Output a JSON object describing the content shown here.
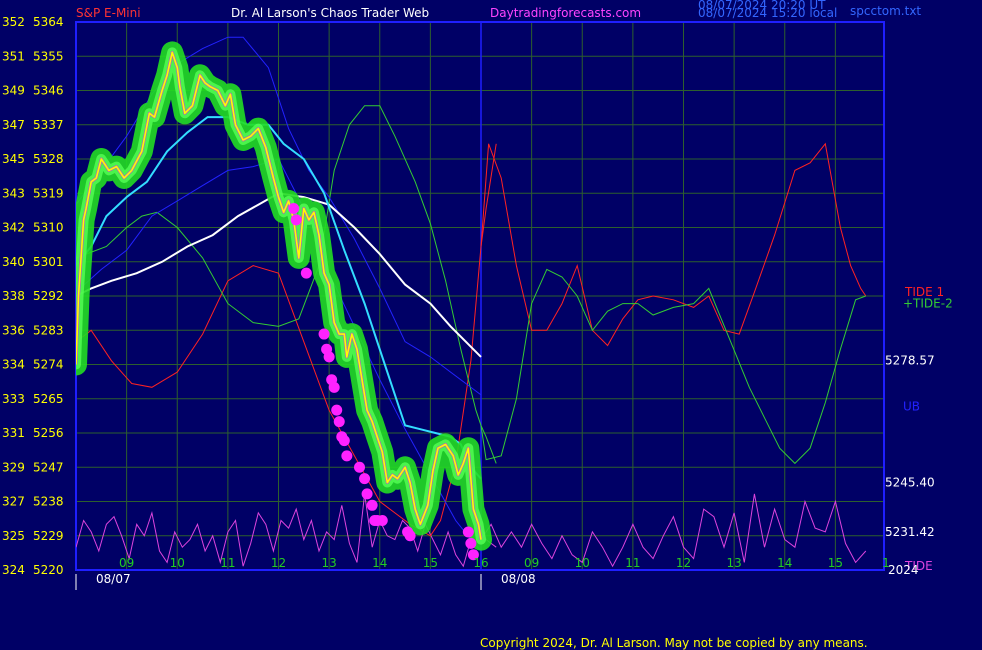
{
  "header": {
    "instrument": "S&P E-Mini",
    "title": "Dr. Al Larson's Chaos Trader Web",
    "site": "Daytradingforecasts.com",
    "stamp_ut": "08/07/2024 20:20 UT",
    "stamp_local": "08/07/2024 15:20 local",
    "file": "spcctom.txt"
  },
  "footer": {
    "copyright": "Copyright 2024, Dr. Al Larson. May not be copied by any means."
  },
  "colors": {
    "background": "#000066",
    "grid": "#2d5f2d",
    "axis": "#1f1fff",
    "title_red": "#ff3333",
    "title_white": "#ffffff",
    "site_magenta": "#ff44ff",
    "stamp_blue": "#3366ff",
    "price": "#ffff00",
    "price_glow": "#22dd22",
    "white_ma": "#ffffff",
    "cyan_ma": "#33ddff",
    "blue_band": "#2222ff",
    "tide1": "#ff2222",
    "tide2": "#33cc33",
    "tide": "#dd44dd"
  },
  "chart_data": {
    "type": "line",
    "x_domain": [
      8.0,
      16.3
    ],
    "forecast_split": 16.0,
    "y_left_pairs": [
      [
        "352",
        "5364"
      ],
      [
        "351",
        "5355"
      ],
      [
        "349",
        "5346"
      ],
      [
        "347",
        "5337"
      ],
      [
        "345",
        "5328"
      ],
      [
        "343",
        "5319"
      ],
      [
        "342",
        "5310"
      ],
      [
        "340",
        "5301"
      ],
      [
        "338",
        "5292"
      ],
      [
        "336",
        "5283"
      ],
      [
        "334",
        "5274"
      ],
      [
        "333",
        "5265"
      ],
      [
        "331",
        "5256"
      ],
      [
        "329",
        "5247"
      ],
      [
        "327",
        "5238"
      ],
      [
        "325",
        "5229"
      ],
      [
        "324",
        "5220"
      ]
    ],
    "ylim": [
      5220,
      5364
    ],
    "x_ticks_day1": [
      "09",
      "10",
      "11",
      "12",
      "13",
      "14",
      "15",
      "16"
    ],
    "x_ticks_day2": [
      "09",
      "10",
      "11",
      "12",
      "13",
      "14",
      "15",
      "1"
    ],
    "date_labels": [
      "08/07",
      "08/08"
    ],
    "right_labels": [
      {
        "text": "5278.57",
        "price": 5275
      },
      {
        "text": "5245.40",
        "price": 5243
      },
      {
        "text": "5231.42",
        "price": 5230
      }
    ],
    "right_series_labels": [
      {
        "text": "TIDE 1",
        "color": "#ff2222",
        "price": 5293
      },
      {
        "text": "+TIDE-2",
        "color": "#33cc33",
        "price": 5290
      },
      {
        "text": "UB",
        "color": "#2222ff",
        "price": 5263
      },
      {
        "text": "TIDE",
        "color": "#dd44dd",
        "price": 5221
      },
      {
        "text": "2024",
        "color": "#ffffff",
        "price": 5220
      }
    ],
    "series": [
      {
        "key": "price",
        "color": "#ffff00",
        "x": [
          8.0,
          8.05,
          8.15,
          8.2,
          8.3,
          8.4,
          8.5,
          8.65,
          8.8,
          8.95,
          9.1,
          9.3,
          9.45,
          9.55,
          9.7,
          9.8,
          9.9,
          10.0,
          10.05,
          10.15,
          10.3,
          10.45,
          10.55,
          10.65,
          10.8,
          10.95,
          11.05,
          11.15,
          11.3,
          11.45,
          11.6,
          11.75,
          11.9,
          12.0,
          12.1,
          12.2,
          12.3,
          12.4,
          12.5,
          12.6,
          12.7,
          12.8,
          12.9,
          13.0,
          13.1,
          13.2,
          13.3,
          13.35,
          13.45,
          13.55,
          13.65,
          13.75,
          13.85,
          13.95,
          14.05,
          14.15,
          14.25,
          14.35,
          14.5,
          14.6,
          14.7,
          14.8,
          14.95,
          15.05,
          15.15,
          15.3,
          15.45,
          15.55,
          15.65,
          15.75,
          15.85,
          15.95,
          16.0
        ],
        "y": [
          5274,
          5292,
          5312,
          5315,
          5322,
          5323,
          5328,
          5325,
          5326,
          5323,
          5325,
          5330,
          5340,
          5339,
          5346,
          5350,
          5356,
          5352,
          5347,
          5340,
          5342,
          5350,
          5348,
          5347,
          5346,
          5342,
          5345,
          5337,
          5333,
          5334,
          5336,
          5331,
          5323,
          5318,
          5314,
          5317,
          5312,
          5302,
          5315,
          5312,
          5314,
          5308,
          5298,
          5295,
          5285,
          5282,
          5282,
          5276,
          5282,
          5278,
          5270,
          5262,
          5259,
          5255,
          5251,
          5243,
          5245,
          5244,
          5247,
          5243,
          5236,
          5232,
          5237,
          5246,
          5252,
          5253,
          5250,
          5245,
          5248,
          5252,
          5236,
          5232,
          5228
        ]
      },
      {
        "key": "white",
        "color": "#ffffff",
        "x": [
          8.0,
          8.3,
          8.7,
          9.2,
          9.7,
          10.2,
          10.7,
          11.2,
          11.6,
          12.0,
          12.5,
          13.0,
          13.5,
          14.0,
          14.5,
          15.0,
          15.4,
          15.7,
          16.0
        ],
        "y": [
          5292,
          5294,
          5296,
          5298,
          5301,
          5305,
          5308,
          5313,
          5316,
          5319,
          5318,
          5316,
          5310,
          5303,
          5295,
          5290,
          5284,
          5280,
          5276
        ]
      },
      {
        "key": "cyan",
        "color": "#33ddff",
        "x": [
          8.0,
          8.3,
          8.6,
          9.0,
          9.4,
          9.8,
          10.2,
          10.6,
          11.0,
          11.4,
          11.8,
          12.1,
          12.5,
          12.9,
          13.3,
          13.7,
          14.1,
          14.5,
          14.8,
          15.1,
          15.4,
          15.6,
          15.8,
          16.0
        ],
        "y": [
          5300,
          5305,
          5313,
          5318,
          5322,
          5330,
          5335,
          5339,
          5339,
          5337,
          5337,
          5332,
          5328,
          5319,
          5304,
          5290,
          5274,
          5258,
          5257,
          5256,
          5255,
          5253,
          5247,
          5244
        ]
      },
      {
        "key": "blue_upper",
        "color": "#2222ff",
        "x": [
          8.0,
          8.5,
          9.0,
          9.5,
          10.0,
          10.5,
          11.0,
          11.3,
          11.8,
          12.2,
          12.6,
          13.0,
          13.5,
          14.0,
          14.5,
          15.0,
          15.4,
          15.7,
          16.0
        ],
        "y": [
          5316,
          5325,
          5334,
          5345,
          5353,
          5357,
          5360,
          5360,
          5352,
          5336,
          5325,
          5318,
          5307,
          5294,
          5280,
          5276,
          5272,
          5269,
          5266
        ]
      },
      {
        "key": "blue_lower",
        "color": "#2222ff",
        "x": [
          8.0,
          8.5,
          9.0,
          9.5,
          10.0,
          10.5,
          11.0,
          11.5,
          12.0,
          12.5,
          13.0,
          13.5,
          14.0,
          14.5,
          15.0,
          15.5,
          15.8,
          16.0
        ],
        "y": [
          5293,
          5299,
          5304,
          5313,
          5317,
          5321,
          5325,
          5326,
          5328,
          5315,
          5298,
          5284,
          5270,
          5257,
          5245,
          5233,
          5228,
          5225
        ]
      },
      {
        "key": "tide1",
        "color": "#ff2222",
        "x": [
          8.0,
          8.3,
          8.7,
          9.1,
          9.5,
          10.0,
          10.5,
          11.0,
          11.5,
          12.0,
          12.5,
          13.0,
          13.5,
          14.0,
          14.3,
          14.6,
          15.0,
          15.2,
          15.5,
          15.8,
          16.0,
          16.1,
          16.3
        ],
        "y": [
          5280,
          5283,
          5275,
          5269,
          5268,
          5272,
          5282,
          5296,
          5300,
          5298,
          5280,
          5262,
          5250,
          5238,
          5235,
          5232,
          5229,
          5233,
          5248,
          5275,
          5305,
          5315,
          5332
        ]
      },
      {
        "key": "tide2",
        "color": "#33cc33",
        "x": [
          8.0,
          8.2,
          8.6,
          9.0,
          9.3,
          9.6,
          10.0,
          10.5,
          11.0,
          11.5,
          12.0,
          12.4,
          12.8,
          13.1,
          13.4,
          13.7,
          14.0,
          14.3,
          14.7,
          15.0,
          15.3,
          15.6,
          15.9,
          16.0,
          16.1,
          16.3
        ],
        "y": [
          5302,
          5303,
          5305,
          5310,
          5313,
          5314,
          5310,
          5302,
          5290,
          5285,
          5284,
          5286,
          5300,
          5325,
          5337,
          5342,
          5342,
          5334,
          5322,
          5311,
          5296,
          5278,
          5262,
          5258,
          5255,
          5248
        ]
      },
      {
        "key": "tide_osc",
        "color": "#dd44dd",
        "x": [
          8.0,
          8.15,
          8.3,
          8.45,
          8.6,
          8.75,
          8.9,
          9.05,
          9.2,
          9.35,
          9.5,
          9.65,
          9.8,
          9.95,
          10.1,
          10.25,
          10.4,
          10.55,
          10.7,
          10.85,
          11.0,
          11.15,
          11.3,
          11.45,
          11.6,
          11.75,
          11.9,
          12.05,
          12.2,
          12.35,
          12.5,
          12.65,
          12.8,
          12.95,
          13.1,
          13.25,
          13.4,
          13.55,
          13.7,
          13.85,
          14.0,
          14.15,
          14.3,
          14.45,
          14.6,
          14.75,
          14.9,
          15.05,
          15.2,
          15.35,
          15.5,
          15.65,
          15.8,
          15.95,
          16.1,
          16.3
        ],
        "y": [
          5226,
          5233,
          5230,
          5225,
          5232,
          5234,
          5229,
          5223,
          5232,
          5229,
          5235,
          5225,
          5222,
          5230,
          5226,
          5228,
          5232,
          5225,
          5229,
          5222,
          5230,
          5233,
          5221,
          5227,
          5235,
          5232,
          5225,
          5233,
          5231,
          5236,
          5228,
          5233,
          5225,
          5230,
          5228,
          5237,
          5227,
          5222,
          5240,
          5226,
          5233,
          5229,
          5228,
          5233,
          5231,
          5225,
          5232,
          5228,
          5224,
          5230,
          5224,
          5221,
          5228,
          5233,
          5228,
          5226
        ]
      }
    ],
    "forecast_series": [
      {
        "key": "tide1_fc",
        "color": "#ff2222",
        "x": [
          16.0,
          16.15,
          16.4,
          16.7,
          17.0,
          17.3,
          17.6,
          17.9,
          18.2,
          18.5,
          18.8,
          19.1,
          19.4,
          19.8,
          20.2,
          20.5,
          20.8,
          21.1,
          21.4,
          21.8,
          22.2,
          22.5,
          22.8,
          23.1,
          23.3,
          23.5,
          23.6
        ],
        "y": [
          5305,
          5332,
          5323,
          5300,
          5283,
          5283,
          5290,
          5300,
          5283,
          5279,
          5286,
          5291,
          5292,
          5291,
          5289,
          5292,
          5283,
          5282,
          5293,
          5308,
          5325,
          5327,
          5332,
          5310,
          5300,
          5294,
          5292
        ]
      },
      {
        "key": "tide2_fc",
        "color": "#33cc33",
        "x": [
          16.0,
          16.1,
          16.4,
          16.7,
          17.0,
          17.3,
          17.6,
          17.9,
          18.2,
          18.5,
          18.8,
          19.1,
          19.4,
          19.8,
          20.2,
          20.5,
          20.9,
          21.3,
          21.6,
          21.9,
          22.2,
          22.5,
          22.8,
          23.1,
          23.4,
          23.6
        ],
        "y": [
          5258,
          5249,
          5250,
          5265,
          5290,
          5299,
          5297,
          5292,
          5283,
          5288,
          5290,
          5290,
          5287,
          5289,
          5290,
          5294,
          5281,
          5268,
          5260,
          5252,
          5248,
          5252,
          5264,
          5278,
          5291,
          5292
        ]
      },
      {
        "key": "tide_fc",
        "color": "#dd44dd",
        "x": [
          16.0,
          16.2,
          16.4,
          16.6,
          16.8,
          17.0,
          17.2,
          17.4,
          17.6,
          17.8,
          18.0,
          18.2,
          18.4,
          18.6,
          18.8,
          19.0,
          19.2,
          19.4,
          19.6,
          19.8,
          20.0,
          20.2,
          20.4,
          20.6,
          20.8,
          21.0,
          21.2,
          21.4,
          21.6,
          21.8,
          22.0,
          22.2,
          22.4,
          22.6,
          22.8,
          23.0,
          23.2,
          23.4,
          23.6
        ],
        "y": [
          5228,
          5232,
          5226,
          5230,
          5226,
          5232,
          5227,
          5223,
          5229,
          5224,
          5222,
          5230,
          5226,
          5221,
          5226,
          5232,
          5226,
          5223,
          5229,
          5234,
          5226,
          5223,
          5236,
          5234,
          5226,
          5235,
          5222,
          5240,
          5226,
          5236,
          5228,
          5226,
          5238,
          5231,
          5230,
          5238,
          5227,
          5222,
          5225
        ]
      }
    ],
    "signal_dots": {
      "color": "#ff22ff",
      "x": [
        12.3,
        12.35,
        12.55,
        12.9,
        12.95,
        13.0,
        13.05,
        13.1,
        13.15,
        13.2,
        13.25,
        13.3,
        13.35,
        13.6,
        13.7,
        13.75,
        13.85,
        13.9,
        13.95,
        14.05,
        14.55,
        14.6,
        15.75,
        15.8,
        15.85
      ],
      "y": [
        5315,
        5312,
        5298,
        5282,
        5278,
        5276,
        5270,
        5268,
        5262,
        5259,
        5255,
        5254,
        5250,
        5247,
        5244,
        5240,
        5237,
        5233,
        5233,
        5233,
        5230,
        5229,
        5230,
        5227,
        5224
      ]
    }
  }
}
